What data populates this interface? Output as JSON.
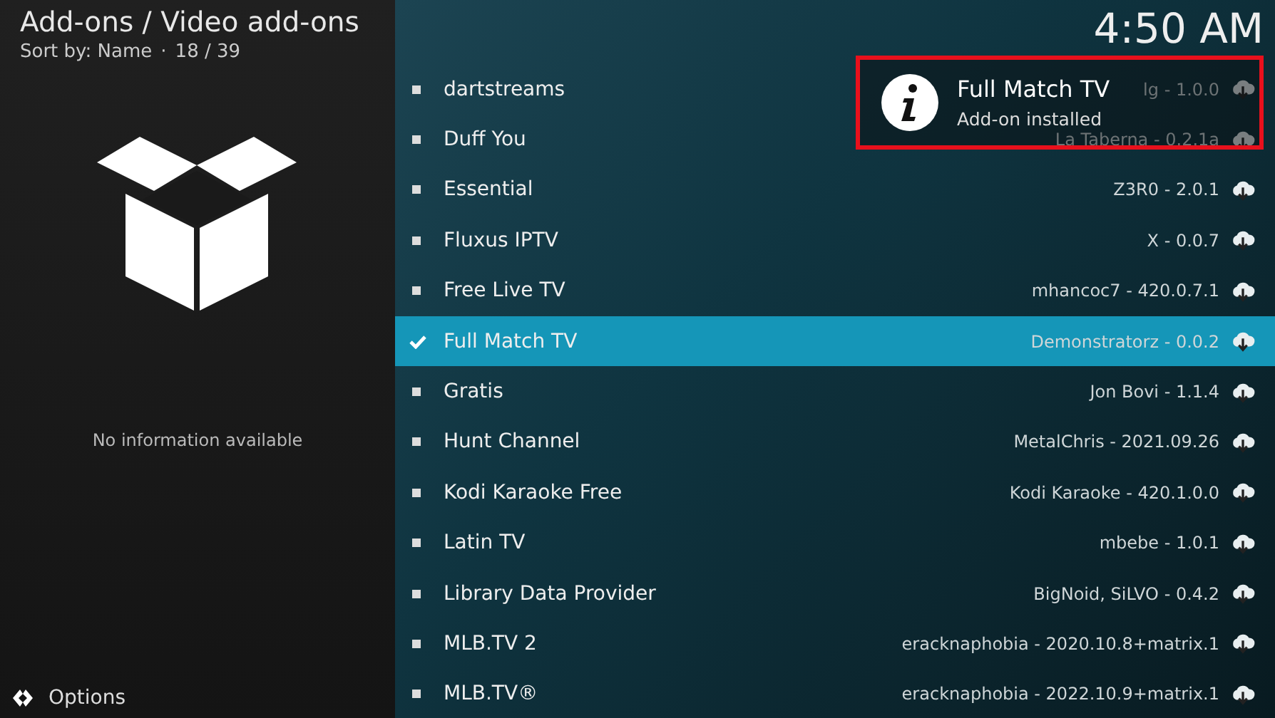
{
  "header": {
    "title": "Add-ons / Video add-ons",
    "sort": "Sort by: Name",
    "separator": "·",
    "position": "18 / 39",
    "clock": "4:50 AM"
  },
  "info_panel": {
    "message": "No information available"
  },
  "options": {
    "label": "Options"
  },
  "addons": [
    {
      "name": "dartstreams",
      "meta": "lg - 1.0.0",
      "selected": false
    },
    {
      "name": "Duff You",
      "meta": "La Taberna - 0.2.1a",
      "selected": false
    },
    {
      "name": "Essential",
      "meta": "Z3R0 - 2.0.1",
      "selected": false
    },
    {
      "name": "Fluxus IPTV",
      "meta": "X - 0.0.7",
      "selected": false
    },
    {
      "name": "Free Live TV",
      "meta": "mhancoc7 - 420.0.7.1",
      "selected": false
    },
    {
      "name": "Full Match TV",
      "meta": "Demonstratorz - 0.0.2",
      "selected": true
    },
    {
      "name": "Gratis",
      "meta": "Jon Bovi - 1.1.4",
      "selected": false
    },
    {
      "name": "Hunt Channel",
      "meta": "MetalChris - 2021.09.26",
      "selected": false
    },
    {
      "name": "Kodi Karaoke Free",
      "meta": "Kodi Karaoke - 420.1.0.0",
      "selected": false
    },
    {
      "name": "Latin TV",
      "meta": "mbebe - 1.0.1",
      "selected": false
    },
    {
      "name": "Library Data Provider",
      "meta": "BigNoid, SiLVO - 0.4.2",
      "selected": false
    },
    {
      "name": "MLB.TV 2",
      "meta": "eracknaphobia - 2020.10.8+matrix.1",
      "selected": false
    },
    {
      "name": "MLB.TV®",
      "meta": "eracknaphobia - 2022.10.9+matrix.1",
      "selected": false
    }
  ],
  "notification": {
    "title": "Full Match TV",
    "message": "Add-on installed",
    "highlighted": true
  }
}
